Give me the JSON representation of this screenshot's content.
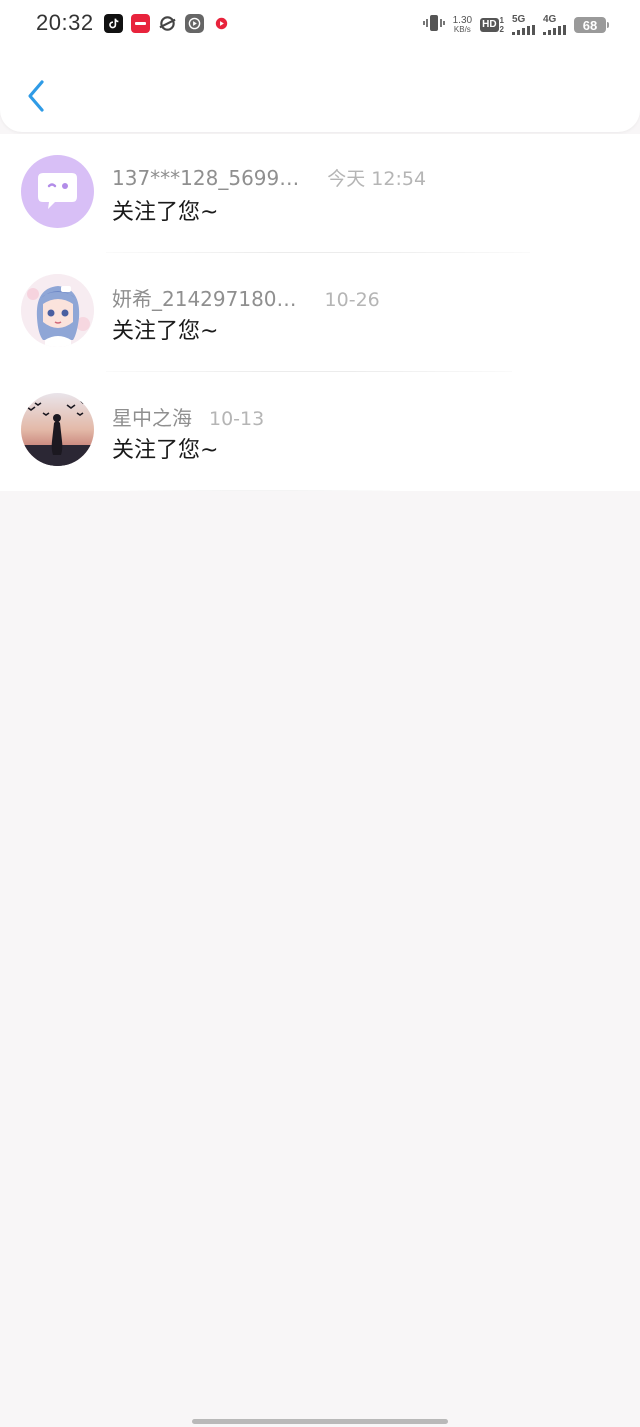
{
  "status_bar": {
    "time": "20:32",
    "net_speed_value": "1.30",
    "net_speed_unit": "KB/s",
    "hd_label": "HD",
    "hd_sub_top": "1",
    "hd_sub_bottom": "2",
    "signal1_label": "5G",
    "signal2_label": "4G",
    "battery": "68"
  },
  "nav": {
    "back_icon": "chevron-left-icon",
    "accent_color": "#2f9be6"
  },
  "messages": [
    {
      "username": "137***128_5699…",
      "time": "今天 12:54",
      "text": "关注了您~",
      "avatar": "chat-bubble-avatar"
    },
    {
      "username": "妍希_214297180…",
      "time": "10-26",
      "text": "关注了您~",
      "avatar": "anime-girl-avatar"
    },
    {
      "username": "星中之海",
      "time": "10-13",
      "text": "关注了您~",
      "avatar": "sunset-silhouette-avatar"
    }
  ]
}
